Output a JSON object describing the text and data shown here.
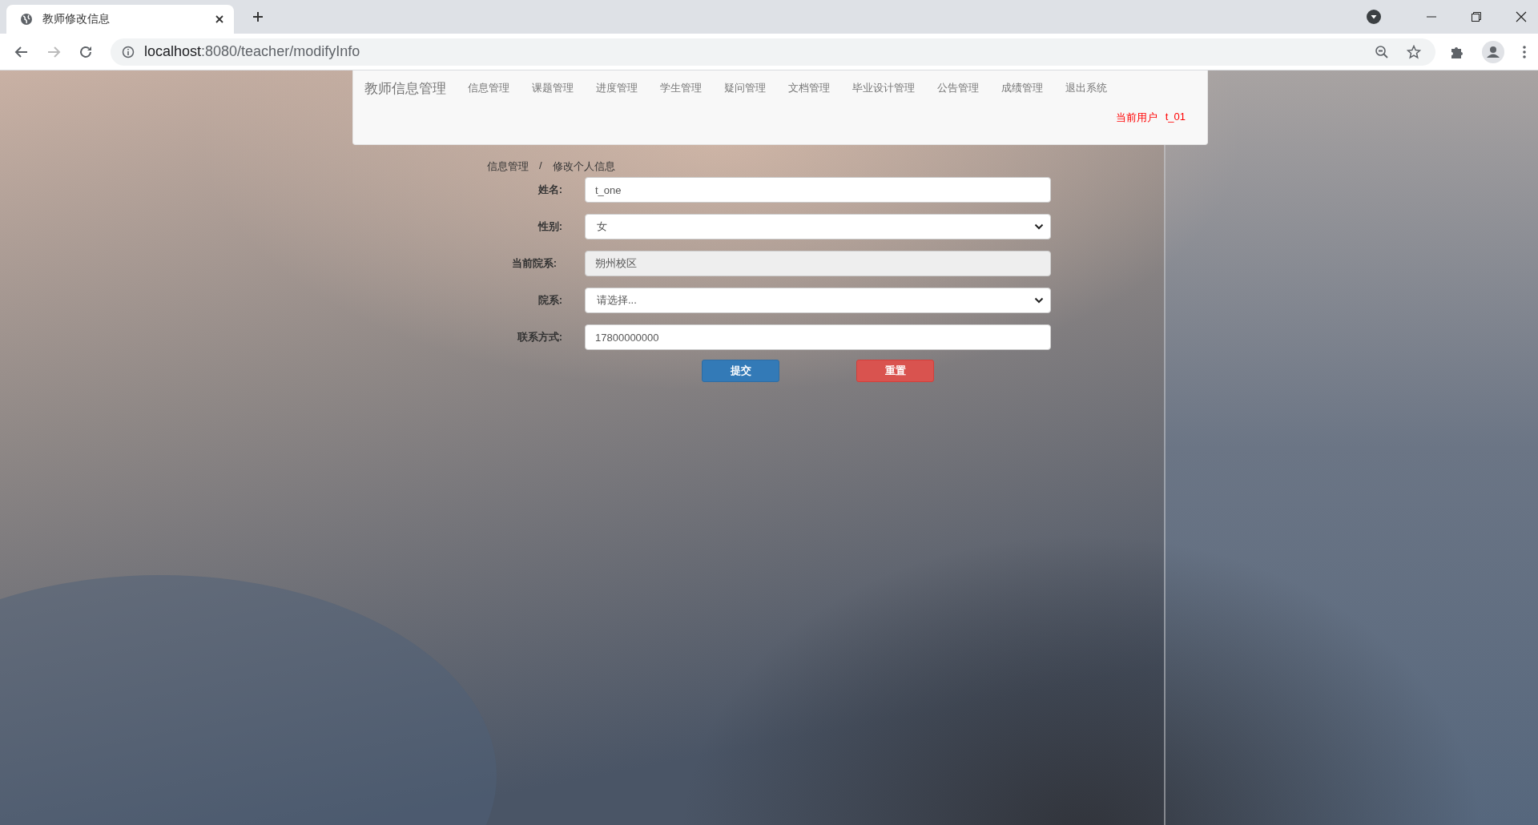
{
  "browser": {
    "tab_title": "教师修改信息",
    "url": {
      "host": "localhost",
      "path": ":8080/teacher/modifyInfo"
    }
  },
  "navbar": {
    "brand": "教师信息管理",
    "items": [
      {
        "label": "信息管理"
      },
      {
        "label": "课题管理"
      },
      {
        "label": "进度管理"
      },
      {
        "label": "学生管理"
      },
      {
        "label": "疑问管理"
      },
      {
        "label": "文档管理"
      },
      {
        "label": "毕业设计管理"
      },
      {
        "label": "公告管理"
      },
      {
        "label": "成绩管理"
      },
      {
        "label": "退出系统"
      }
    ],
    "current_user_label": "当前用户",
    "current_user": "t_01"
  },
  "breadcrumb": {
    "items": [
      "信息管理",
      "修改个人信息"
    ],
    "separator": "/"
  },
  "form": {
    "fields": [
      {
        "kind": "text",
        "label": "姓名:",
        "value": "t_one"
      },
      {
        "kind": "select",
        "label": "性别:",
        "value": "女"
      },
      {
        "kind": "readonly",
        "label": "当前院系:",
        "value": "朔州校区"
      },
      {
        "kind": "select",
        "label": "院系:",
        "value": "请选择..."
      },
      {
        "kind": "text",
        "label": "联系方式:",
        "value": "17800000000"
      }
    ],
    "buttons": [
      {
        "kind": "primary",
        "label": "提交"
      },
      {
        "kind": "danger",
        "label": "重置"
      }
    ]
  }
}
